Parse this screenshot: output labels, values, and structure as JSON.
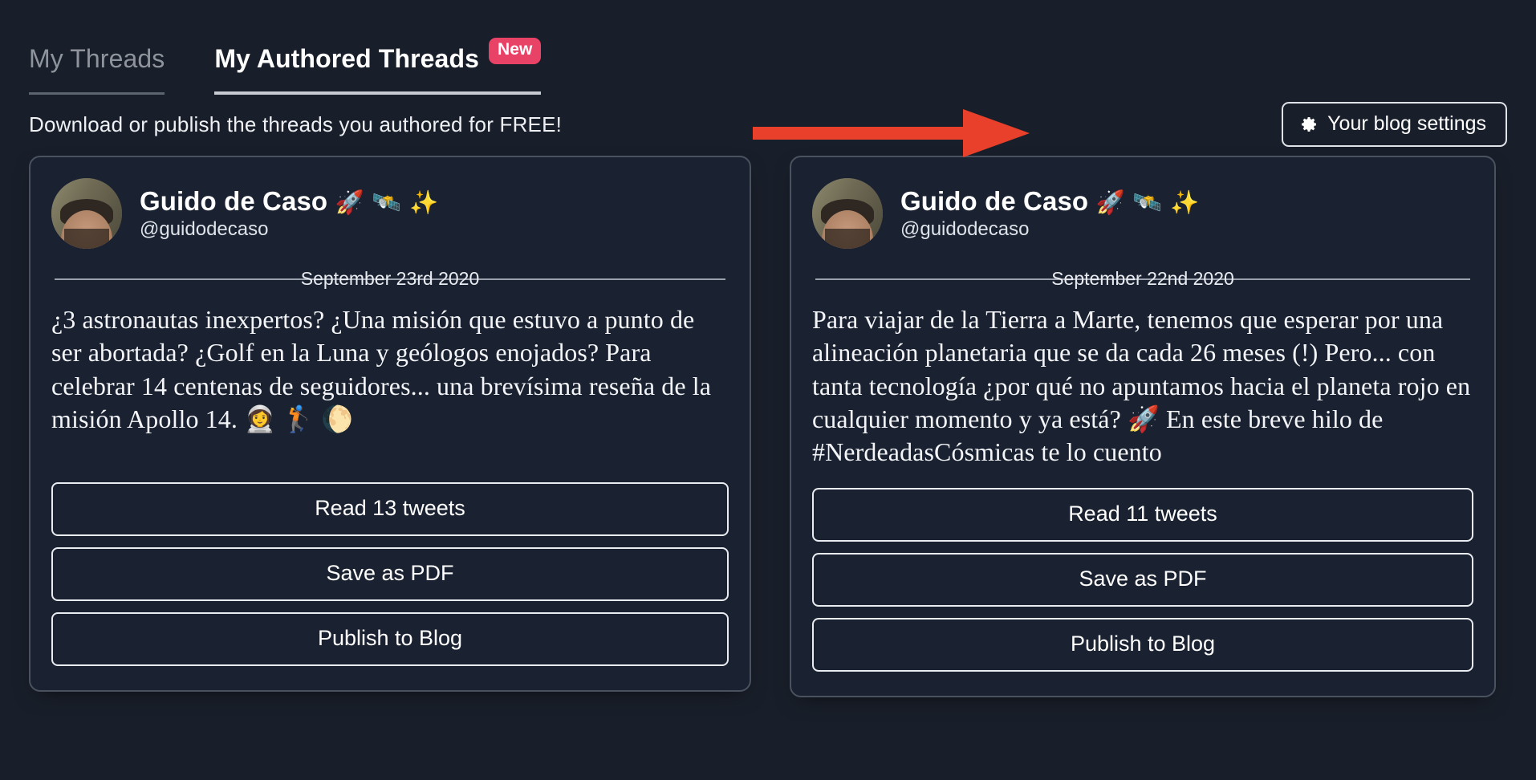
{
  "colors": {
    "background": "#191f2a",
    "card_background": "#1a2130",
    "card_border": "#4a5260",
    "badge_pink": "#e94267",
    "arrow_red": "#e8402a",
    "text_primary": "#ffffff",
    "text_muted": "#8e939c"
  },
  "tabs": [
    {
      "label": "My Threads",
      "active": false
    },
    {
      "label": "My Authored Threads",
      "active": true,
      "badge": "New"
    }
  ],
  "header": {
    "subtitle": "Download or publish the threads you authored for FREE!",
    "settings_button": {
      "label": "Your blog settings",
      "icon": "gear-icon"
    },
    "annotation_arrow": "red-right-arrow"
  },
  "threads": [
    {
      "author": {
        "display_name": "Guido de Caso",
        "name_emojis": "🚀 🛰️ ✨",
        "handle": "@guidodecaso",
        "avatar": "profile-photo"
      },
      "date": "September 23rd 2020",
      "text": "¿3 astronautas inexpertos? ¿Una misión que estuvo a punto de ser abortada? ¿Golf en la Luna y geólogos enojados? Para celebrar 14 centenas de seguidores... una brevísima reseña de la misión Apollo 14. 👩‍🚀 🏌️ 🌔",
      "actions": {
        "read": "Read 13 tweets",
        "save_pdf": "Save as PDF",
        "publish": "Publish to Blog"
      },
      "tweet_count": 13
    },
    {
      "author": {
        "display_name": "Guido de Caso",
        "name_emojis": "🚀 🛰️ ✨",
        "handle": "@guidodecaso",
        "avatar": "profile-photo"
      },
      "date": "September 22nd 2020",
      "text": "Para viajar de la Tierra a Marte, tenemos que esperar por una alineación planetaria que se da cada 26 meses (!) Pero... con tanta tecnología ¿por qué no apuntamos hacia el planeta rojo en cualquier momento y ya está? 🚀 En este breve hilo de #NerdeadasCósmicas te lo cuento",
      "actions": {
        "read": "Read 11 tweets",
        "save_pdf": "Save as PDF",
        "publish": "Publish to Blog"
      },
      "tweet_count": 11
    }
  ]
}
